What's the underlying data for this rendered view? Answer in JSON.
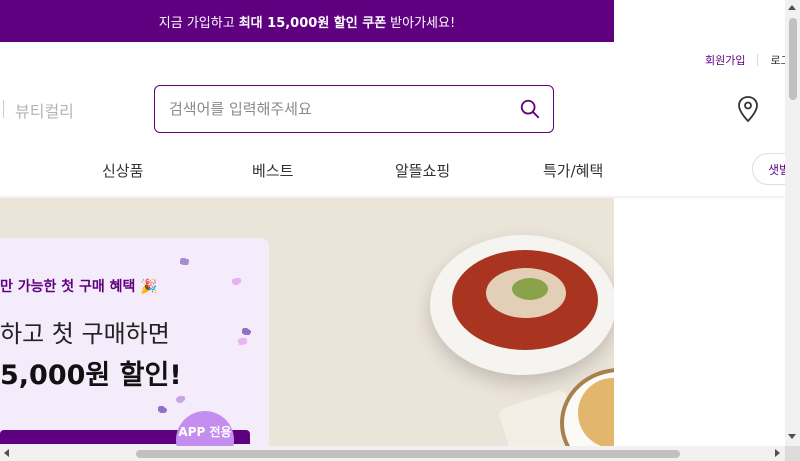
{
  "topbar": {
    "prefix": "지금 가입하고",
    "highlight_1": "최대 15,000원 할인 쿠폰",
    "suffix": "받아가세요!"
  },
  "user_menu": {
    "signup": "회원가입",
    "login": "로그"
  },
  "brand": {
    "beauty_label": "뷰티컬리"
  },
  "search": {
    "placeholder": "검색어를 입력해주세요",
    "value": ""
  },
  "nav": {
    "items": [
      "신상품",
      "베스트",
      "알뜰쇼핑",
      "특가/혜택"
    ],
    "cta_label": "샛별"
  },
  "banner": {
    "line1": "만 가능한 첫 구매 혜택 🎉",
    "line2": "하고 첫 구매하면",
    "line3": "5,000원 할인!",
    "app_badge": "APP 전용"
  },
  "colors": {
    "brand_purple": "#5f0080",
    "promo_bg": "#f4ecfa",
    "banner_bg": "#ebe4d9"
  },
  "icons": [
    "search-icon",
    "location-pin-icon"
  ]
}
